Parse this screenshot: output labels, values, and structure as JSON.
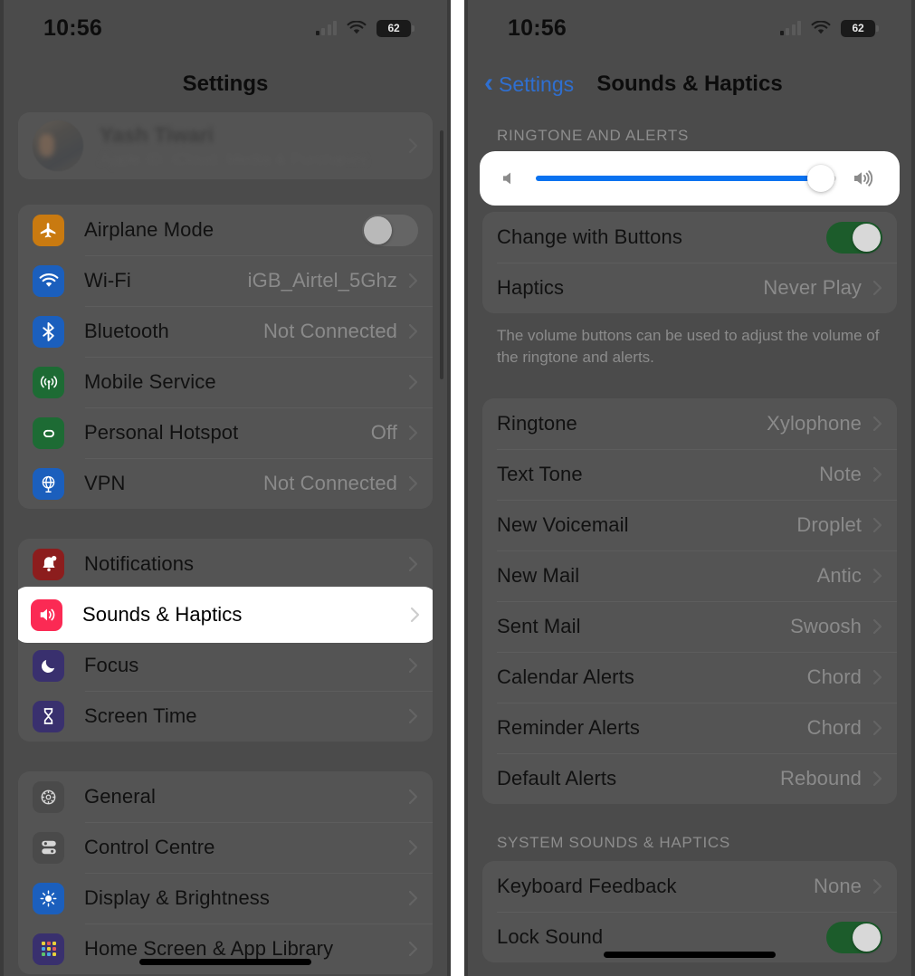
{
  "status_bar": {
    "time": "10:56",
    "battery_percent": "62",
    "cellular_icon": "cellular-signal-icon",
    "wifi_icon": "wifi-icon",
    "battery_icon": "battery-icon"
  },
  "left_panel": {
    "nav_title": "Settings",
    "profile": {
      "name": "Yash Tiwari",
      "subtitle": "Apple ID, iCloud, Media & Purchases"
    },
    "groups": [
      {
        "rows": [
          {
            "label": "Airplane Mode",
            "value": "",
            "icon": "airplane-icon",
            "color": "#c97a10",
            "control": "toggle-off"
          },
          {
            "label": "Wi-Fi",
            "value": "iGB_Airtel_5Ghz",
            "icon": "wifi-icon",
            "color": "#1b5fbd",
            "control": "chevron"
          },
          {
            "label": "Bluetooth",
            "value": "Not Connected",
            "icon": "bluetooth-icon",
            "color": "#1b5fbd",
            "control": "chevron"
          },
          {
            "label": "Mobile Service",
            "value": "",
            "icon": "antenna-icon",
            "color": "#1d6b34",
            "control": "chevron"
          },
          {
            "label": "Personal Hotspot",
            "value": "Off",
            "icon": "hotspot-icon",
            "color": "#1d6b34",
            "control": "chevron"
          },
          {
            "label": "VPN",
            "value": "Not Connected",
            "icon": "globe-icon",
            "color": "#1b5fbd",
            "control": "chevron"
          }
        ]
      },
      {
        "rows": [
          {
            "label": "Notifications",
            "value": "",
            "icon": "bell-icon",
            "color": "#8c1d1d",
            "control": "chevron"
          },
          {
            "label": "Sounds & Haptics",
            "value": "",
            "icon": "speaker-icon",
            "color": "#fb2a54",
            "control": "chevron",
            "highlighted": true
          },
          {
            "label": "Focus",
            "value": "",
            "icon": "moon-icon",
            "color": "#39306e",
            "control": "chevron"
          },
          {
            "label": "Screen Time",
            "value": "",
            "icon": "hourglass-icon",
            "color": "#39306e",
            "control": "chevron"
          }
        ]
      },
      {
        "rows": [
          {
            "label": "General",
            "value": "",
            "icon": "gear-icon",
            "color": "#4a4a4a",
            "control": "chevron"
          },
          {
            "label": "Control Centre",
            "value": "",
            "icon": "control-centre-icon",
            "color": "#4a4a4a",
            "control": "chevron"
          },
          {
            "label": "Display & Brightness",
            "value": "",
            "icon": "brightness-icon",
            "color": "#1b5fbd",
            "control": "chevron"
          },
          {
            "label": "Home Screen & App Library",
            "value": "",
            "icon": "app-grid-icon",
            "color": "#39306e",
            "control": "chevron"
          }
        ]
      }
    ]
  },
  "right_panel": {
    "back_label": "Settings",
    "nav_title": "Sounds & Haptics",
    "section_1_header": "RINGTONE AND ALERTS",
    "volume_slider": {
      "value_percent": 95,
      "min_icon": "speaker-low-icon",
      "max_icon": "speaker-high-icon"
    },
    "section_1_rows": [
      {
        "label": "Change with Buttons",
        "value": "",
        "control": "toggle-on"
      },
      {
        "label": "Haptics",
        "value": "Never Play",
        "control": "chevron"
      }
    ],
    "section_1_footer": "The volume buttons can be used to adjust the volume of the ringtone and alerts.",
    "section_2_rows": [
      {
        "label": "Ringtone",
        "value": "Xylophone",
        "control": "chevron"
      },
      {
        "label": "Text Tone",
        "value": "Note",
        "control": "chevron"
      },
      {
        "label": "New Voicemail",
        "value": "Droplet",
        "control": "chevron"
      },
      {
        "label": "New Mail",
        "value": "Antic",
        "control": "chevron"
      },
      {
        "label": "Sent Mail",
        "value": "Swoosh",
        "control": "chevron"
      },
      {
        "label": "Calendar Alerts",
        "value": "Chord",
        "control": "chevron"
      },
      {
        "label": "Reminder Alerts",
        "value": "Chord",
        "control": "chevron"
      },
      {
        "label": "Default Alerts",
        "value": "Rebound",
        "control": "chevron"
      }
    ],
    "section_3_header": "SYSTEM SOUNDS & HAPTICS",
    "section_3_rows": [
      {
        "label": "Keyboard Feedback",
        "value": "None",
        "control": "chevron"
      },
      {
        "label": "Lock Sound",
        "value": "",
        "control": "toggle-on"
      }
    ]
  }
}
